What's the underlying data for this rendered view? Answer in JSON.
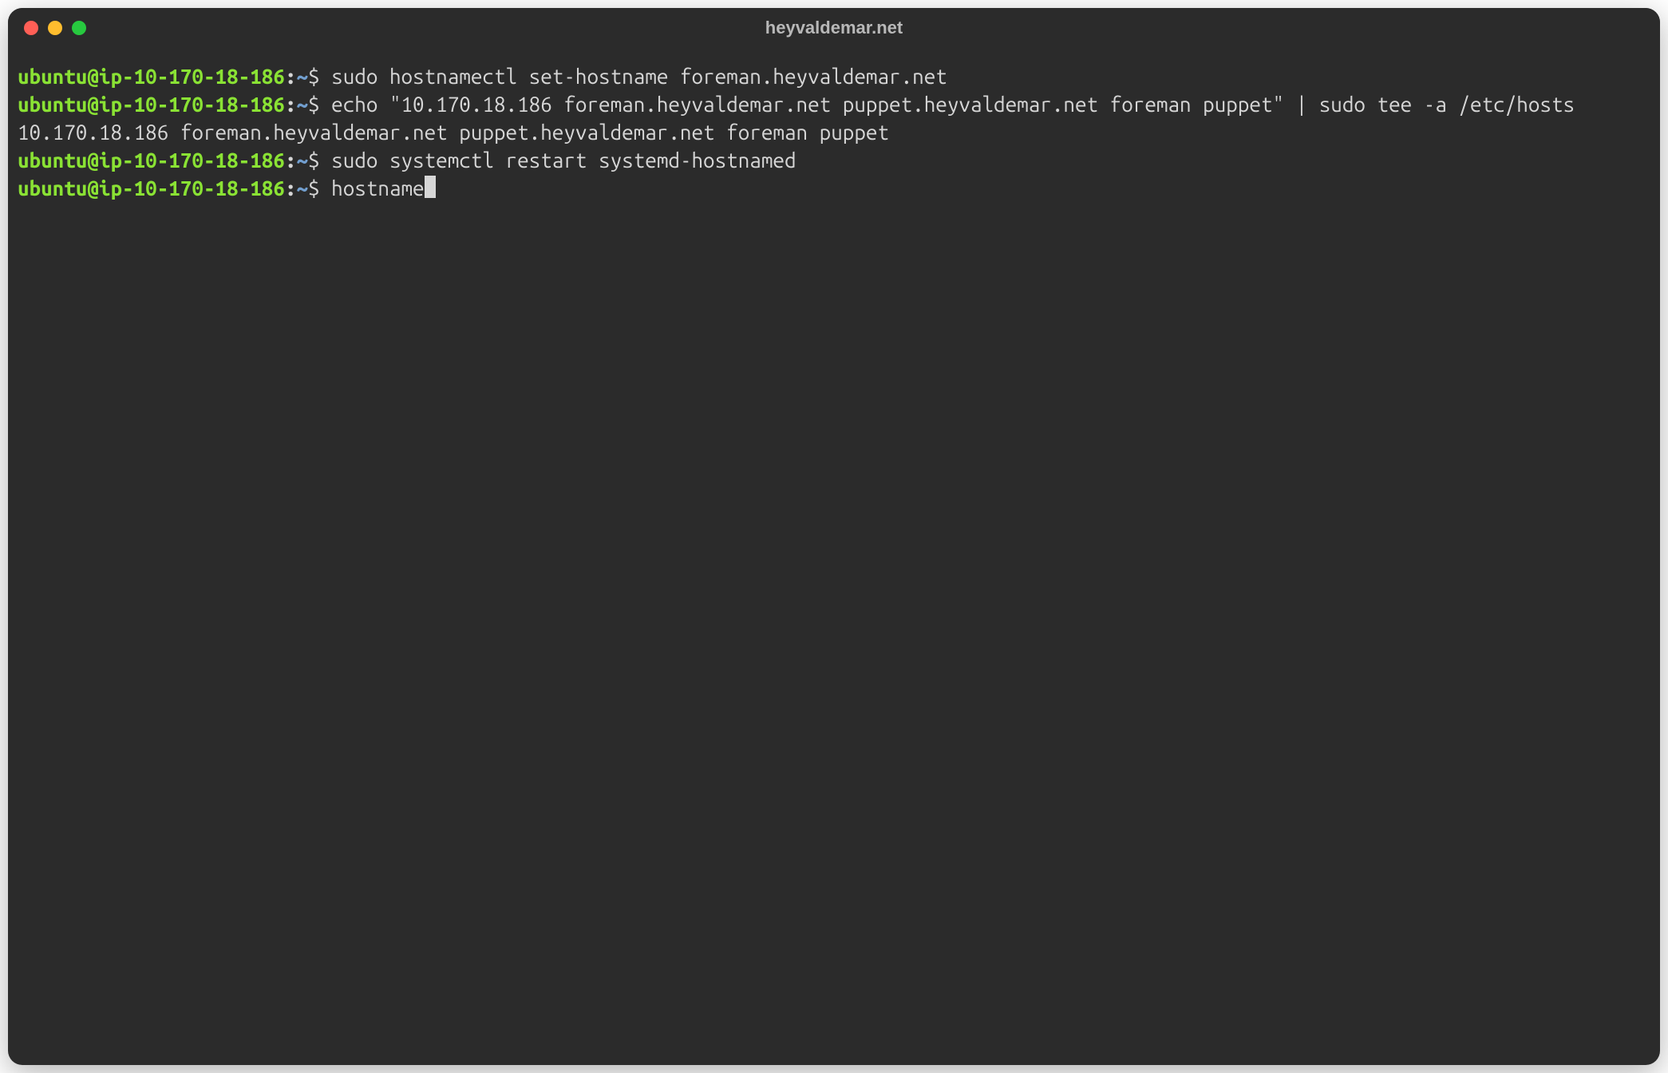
{
  "window": {
    "title": "heyvaldemar.net"
  },
  "prompt": {
    "user_host": "ubuntu@ip-10-170-18-186",
    "colon": ":",
    "path": "~",
    "dollar": "$"
  },
  "lines": [
    {
      "type": "cmd",
      "command": "sudo hostnamectl set-hostname foreman.heyvaldemar.net"
    },
    {
      "type": "cmd",
      "command": "echo \"10.170.18.186 foreman.heyvaldemar.net puppet.heyvaldemar.net foreman puppet\" | sudo tee -a /etc/hosts"
    },
    {
      "type": "out",
      "text": "10.170.18.186 foreman.heyvaldemar.net puppet.heyvaldemar.net foreman puppet"
    },
    {
      "type": "cmd",
      "command": "sudo systemctl restart systemd-hostnamed"
    },
    {
      "type": "cmd",
      "command": "hostname",
      "cursor": true
    }
  ]
}
